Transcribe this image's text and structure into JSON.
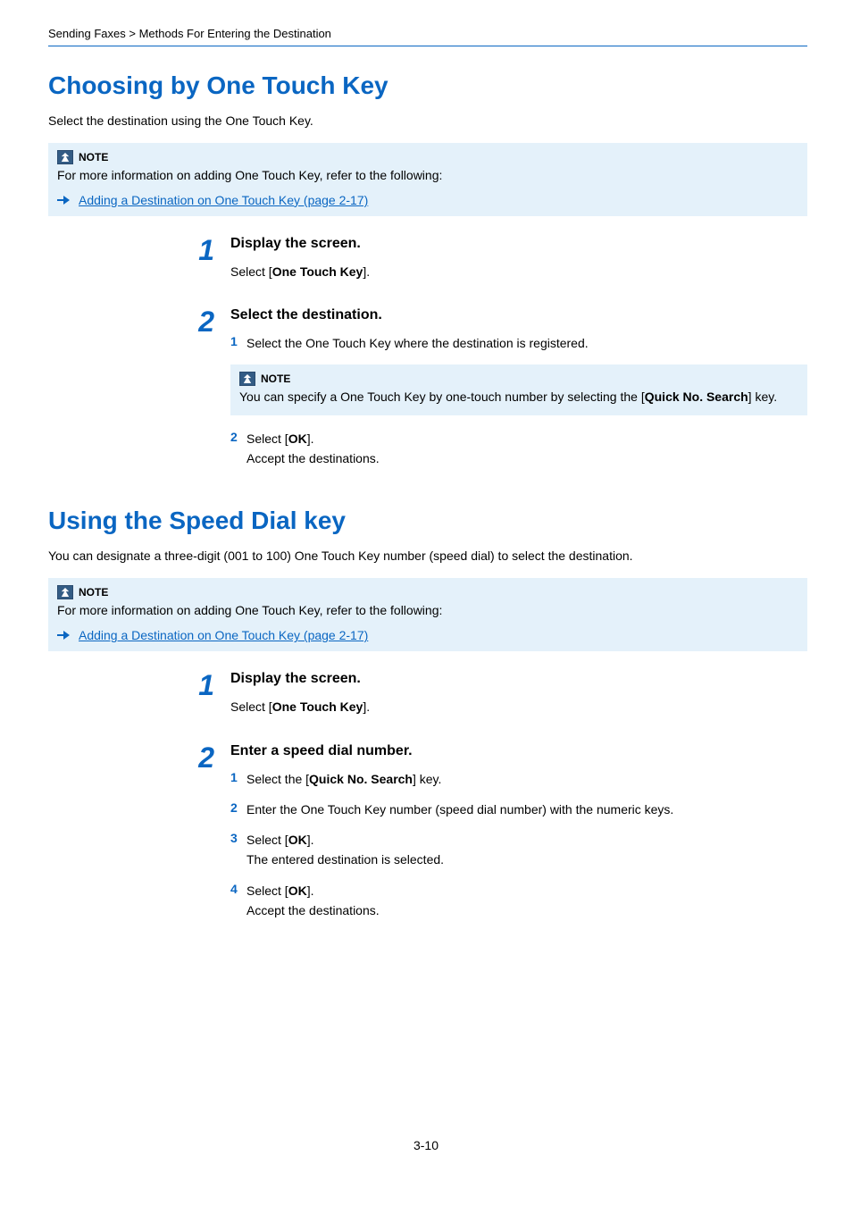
{
  "breadcrumb": {
    "section": "Sending Faxes",
    "sep": ">",
    "page": "Methods For Entering the Destination"
  },
  "s1": {
    "heading": "Choosing by One Touch Key",
    "intro": "Select the destination using the One Touch Key.",
    "note": {
      "label": "NOTE",
      "text": "For more information on adding One Touch Key, refer to the following:",
      "link": "Adding a Destination on One Touch Key (page 2-17)"
    },
    "steps": [
      {
        "num": "1",
        "title": "Display the screen.",
        "text_pre": "Select [",
        "text_bold": "One Touch Key",
        "text_post": "]."
      },
      {
        "num": "2",
        "title": "Select the destination.",
        "sub": [
          {
            "num": "1",
            "text": "Select the One Touch Key where the destination is registered."
          }
        ],
        "inner_note": {
          "label": "NOTE",
          "text_pre": "You can specify a One Touch Key by one-touch number by selecting the [",
          "text_bold": "Quick No. Search",
          "text_post": "] key."
        },
        "sub2": [
          {
            "num": "2",
            "line1_pre": "Select [",
            "line1_bold": "OK",
            "line1_post": "].",
            "line2": "Accept the destinations."
          }
        ]
      }
    ]
  },
  "s2": {
    "heading": "Using the Speed Dial key",
    "intro": "You can designate a three-digit (001 to 100) One Touch Key number (speed dial) to select the destination.",
    "note": {
      "label": "NOTE",
      "text": "For more information on adding One Touch Key, refer to the following:",
      "link": "Adding a Destination on One Touch Key (page 2-17)"
    },
    "steps": [
      {
        "num": "1",
        "title": "Display the screen.",
        "text_pre": "Select [",
        "text_bold": "One Touch Key",
        "text_post": "]."
      },
      {
        "num": "2",
        "title": "Enter a speed dial number.",
        "sub": [
          {
            "num": "1",
            "text_pre": "Select the [",
            "text_bold": "Quick No. Search",
            "text_post": "] key."
          },
          {
            "num": "2",
            "text": "Enter the One Touch Key number (speed dial number) with the numeric keys."
          },
          {
            "num": "3",
            "line1_pre": "Select [",
            "line1_bold": "OK",
            "line1_post": "].",
            "line2": "The entered destination is selected."
          },
          {
            "num": "4",
            "line1_pre": "Select [",
            "line1_bold": "OK",
            "line1_post": "].",
            "line2": "Accept the destinations."
          }
        ]
      }
    ]
  },
  "footer": "3-10"
}
